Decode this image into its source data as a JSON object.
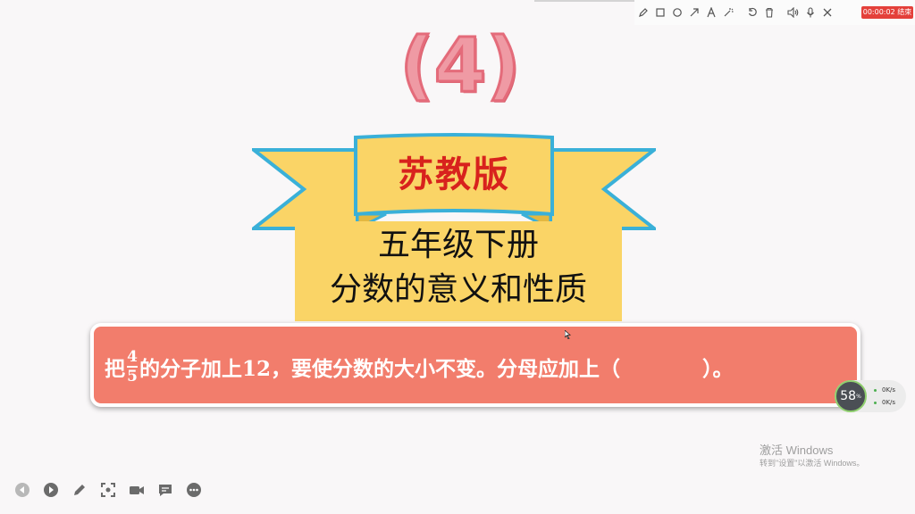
{
  "toolbar": {
    "icons": [
      "pen-icon",
      "rectangle-icon",
      "circle-icon",
      "arrow-icon",
      "text-icon",
      "magic-wand-icon",
      "undo-icon",
      "trash-icon",
      "speaker-icon",
      "microphone-icon",
      "close-icon"
    ],
    "recording_time": "00:00:02",
    "recording_end": "结束"
  },
  "slide": {
    "lesson_number": "(4)",
    "publisher": "苏教版",
    "grade": "五年级下册",
    "unit": "分数的意义和性质",
    "question": {
      "prefix": "把",
      "fraction_numerator": "4",
      "fraction_denominator": "5",
      "suffix": "的分子加上12，要使分数的大小不变。分母应加上（　　　　）。"
    }
  },
  "meter": {
    "percent": "58",
    "percent_unit": "%",
    "upload": "0",
    "upload_unit": "K/s",
    "download": "0",
    "download_unit": "K/s"
  },
  "watermark": {
    "line1": "激活 Windows",
    "line2": "转到\"设置\"以激活 Windows。"
  },
  "colors": {
    "title_pink": "#ef9aa4",
    "ribbon_yellow": "#fad466",
    "ribbon_border": "#3ab0d8",
    "publisher_red": "#d8221d",
    "question_bg": "#f27d6c",
    "record_red": "#e4403a"
  }
}
